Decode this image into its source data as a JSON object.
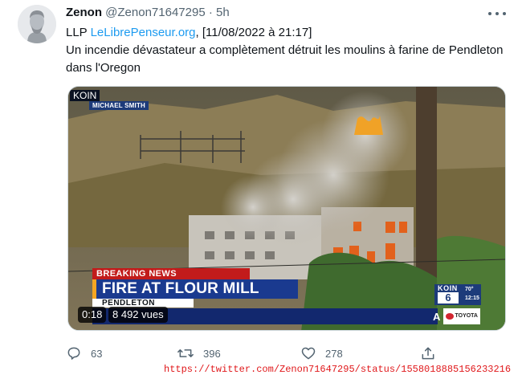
{
  "tweet": {
    "author_name": "Zenon",
    "author_handle": "@Zenon71647295",
    "separator": "·",
    "time": "5h",
    "text_prefix": "LLP ",
    "text_link": "LeLibrePenseur.org",
    "text_date": ", [11/08/2022 à 21:17]",
    "text_body": "Un incendie dévastateur a complètement détruit les moulins à farine de Pendleton dans l'Oregon"
  },
  "video": {
    "channel_tag": "KOIN",
    "reporter": "MICHAEL SMITH",
    "breaking": "BREAKING NEWS",
    "headline": "FIRE AT FLOUR MILL",
    "location": "PENDLETON",
    "ticker_letter": "A",
    "sponsor": "TOYOTA",
    "station_name": "KOIN",
    "station_channel": "6",
    "station_temp": "70°",
    "station_time": "12:15",
    "timestamp": "0:18",
    "views": "8 492 vues"
  },
  "actions": {
    "replies": "63",
    "retweets": "396",
    "likes": "278"
  },
  "source_url": "https://twitter.com/Zenon71647295/status/1558018885156233216",
  "colors": {
    "accent": "#1d9bf0",
    "muted": "#536471",
    "url": "#e0181b",
    "breaking_red": "#c21b1b",
    "headline_blue": "#1a3a8f"
  },
  "icons": {
    "reply": "reply-icon",
    "retweet": "retweet-icon",
    "like": "heart-icon",
    "share": "share-icon",
    "more": "more-icon"
  }
}
